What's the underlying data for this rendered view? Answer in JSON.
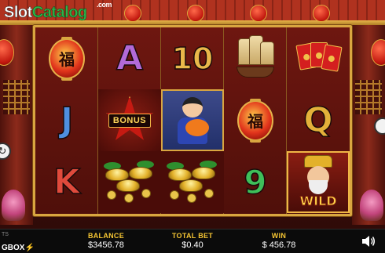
{
  "watermark": {
    "part1": "Slot",
    "part2": "Catalog",
    "suffix": ".com"
  },
  "reels": [
    [
      "lantern",
      "J",
      "K"
    ],
    [
      "A",
      "bonus",
      "gold"
    ],
    [
      "10",
      "girl",
      "gold"
    ],
    [
      "ship",
      "lantern",
      "9"
    ],
    [
      "envelopes",
      "Q",
      "wild"
    ]
  ],
  "symbols": {
    "lantern_glyph": "福",
    "letter_a": "A",
    "letter_j": "J",
    "letter_k": "K",
    "letter_q": "Q",
    "num_10": "10",
    "num_9": "9",
    "bonus_label": "BONUS",
    "wild_label": "WILD"
  },
  "bottom_bar": {
    "brand_partial": "GBOX",
    "brand_top": "TS",
    "balance_label": "BALANCE",
    "balance_value": "$3456.78",
    "total_bet_label": "TOTAL BET",
    "total_bet_value": "$0.40",
    "win_label": "WIN",
    "win_value": "$ 456.78",
    "sound_icon": "speaker-icon"
  },
  "colors": {
    "accent_gold": "#f5c533",
    "frame_gold": "#d9a640",
    "background_red": "#6b1a12"
  }
}
